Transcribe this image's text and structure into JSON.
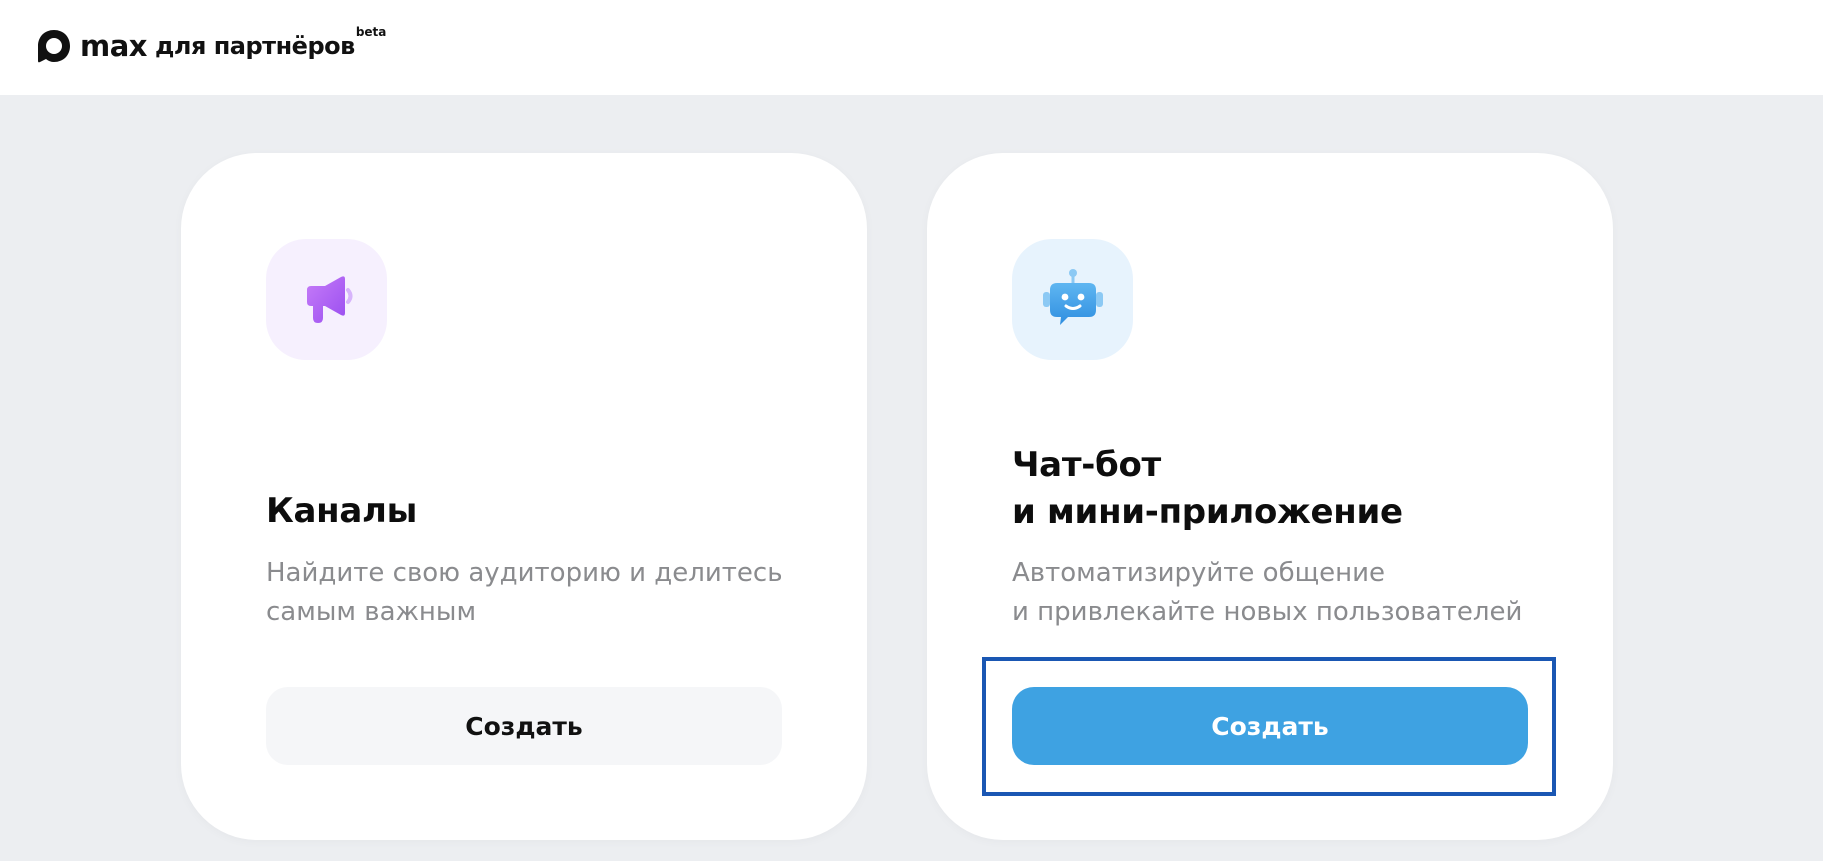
{
  "header": {
    "logo_word": "max",
    "logo_sub": "для партнёров",
    "logo_badge": "beta"
  },
  "cards": [
    {
      "icon": "megaphone-icon",
      "title_lines": [
        "Каналы"
      ],
      "description_lines": [
        "Найдите свою аудиторию и делитесь",
        "самым важным"
      ],
      "button_label": "Создать"
    },
    {
      "icon": "chatbot-icon",
      "title_lines": [
        "Чат-бот",
        "и мини-приложение"
      ],
      "description_lines": [
        "Автоматизируйте общение",
        "и привлекайте новых пользователей"
      ],
      "button_label": "Создать"
    }
  ],
  "colors": {
    "background": "#eceef1",
    "primary_button": "#3ea2e2",
    "secondary_button": "#f5f6f8",
    "highlight_border": "#1a57b3",
    "megaphone_accent": "#b15ef5",
    "bot_accent": "#3d9ce6"
  }
}
